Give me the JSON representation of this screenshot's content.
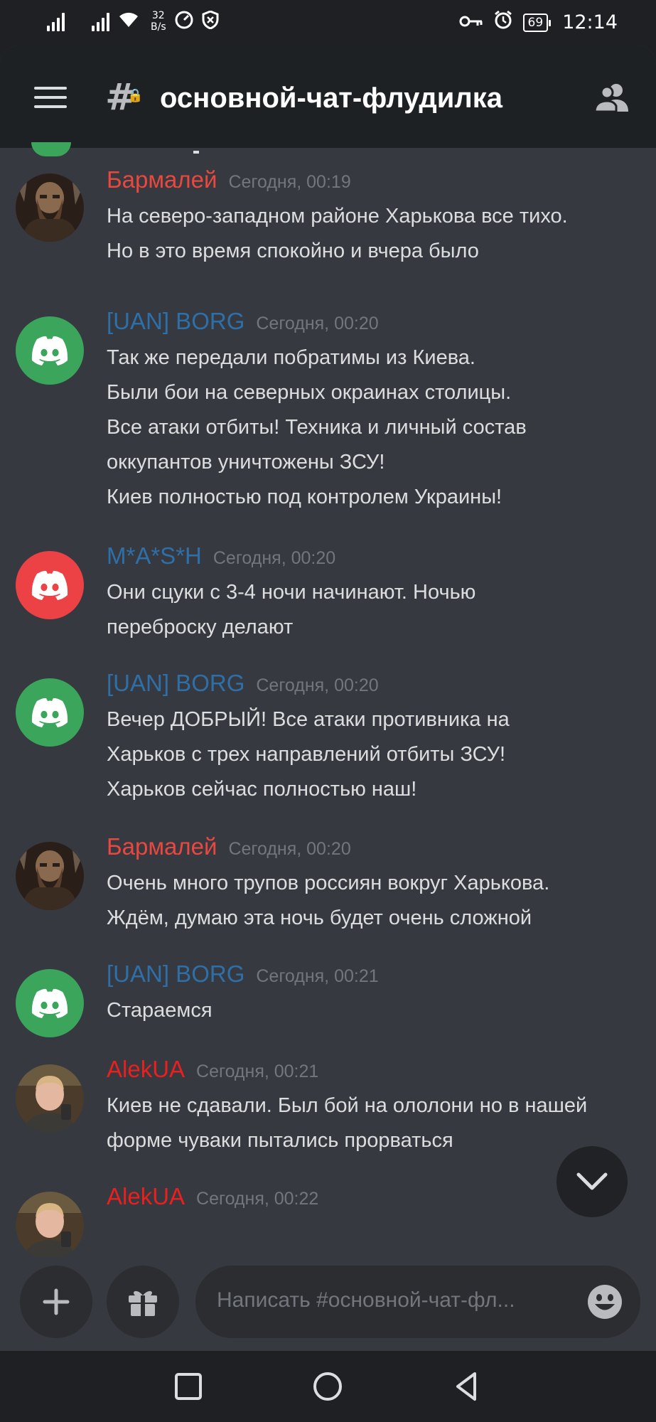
{
  "status_bar": {
    "speed_value": "32",
    "speed_unit": "B/s",
    "battery": "69",
    "time": "12:14"
  },
  "header": {
    "channel_name": "основной-чат-флудилка",
    "channel_icon": "hash-lock-icon",
    "menu_icon": "hamburger-icon",
    "members_icon": "members-icon"
  },
  "messages": [
    {
      "author": "Бармалей",
      "author_color": "#e8483f",
      "timestamp": "Сегодня, 00:19",
      "avatar": "photo-warrior",
      "lines": [
        "На северо-западном районе Харькова все тихо.",
        "Но в это время спокойно и вчера было"
      ]
    },
    {
      "author": "[UAN] BORG",
      "author_color": "#2f6fa8",
      "timestamp": "Сегодня, 00:20",
      "avatar": "discord-green",
      "lines": [
        "Так же передали побратимы из Киева.",
        "Были бои на северных окраинах столицы.",
        "Все атаки отбиты! Техника и личный состав",
        "оккупантов уничтожены ЗСУ!",
        "Киев полностью под контролем Украины!"
      ]
    },
    {
      "author": "M*A*S*H",
      "author_color": "#2f6fa8",
      "timestamp": "Сегодня, 00:20",
      "avatar": "discord-red",
      "lines": [
        "Они сцуки с 3-4 ночи начинают. Ночью",
        "переброску делают"
      ]
    },
    {
      "author": "[UAN] BORG",
      "author_color": "#2f6fa8",
      "timestamp": "Сегодня, 00:20",
      "avatar": "discord-green",
      "lines": [
        "Вечер ДОБРЫЙ! Все атаки противника на",
        "Харьков с трех направлений отбиты ЗСУ!",
        "Харьков сейчас полностью наш!"
      ]
    },
    {
      "author": "Бармалей",
      "author_color": "#e8483f",
      "timestamp": "Сегодня, 00:20",
      "avatar": "photo-warrior",
      "lines": [
        "Очень много трупов россиян вокруг Харькова.",
        "Ждём, думаю эта ночь будет очень сложной"
      ]
    },
    {
      "author": "[UAN] BORG",
      "author_color": "#2f6fa8",
      "timestamp": "Сегодня, 00:21",
      "avatar": "discord-green",
      "lines": [
        "Стараемся"
      ]
    },
    {
      "author": "AlekUA",
      "author_color": "#e8201f",
      "timestamp": "Сегодня, 00:21",
      "avatar": "photo-man",
      "lines": [
        "Киев не сдавали. Был бой на ололони но в нашей",
        "форме чуваки пытались прорваться"
      ]
    },
    {
      "author": "AlekUA",
      "author_color": "#e8201f",
      "timestamp": "Сегодня, 00:22",
      "avatar": "photo-man",
      "lines": []
    }
  ],
  "composer": {
    "placeholder": "Написать #основной-чат-фл...",
    "plus_icon": "plus-icon",
    "gift_icon": "gift-icon",
    "emoji_icon": "emoji-icon"
  },
  "scroll_button_icon": "chevron-down-icon",
  "nav_bar": {
    "icons": [
      "recent-apps-icon",
      "home-icon",
      "back-icon"
    ]
  }
}
